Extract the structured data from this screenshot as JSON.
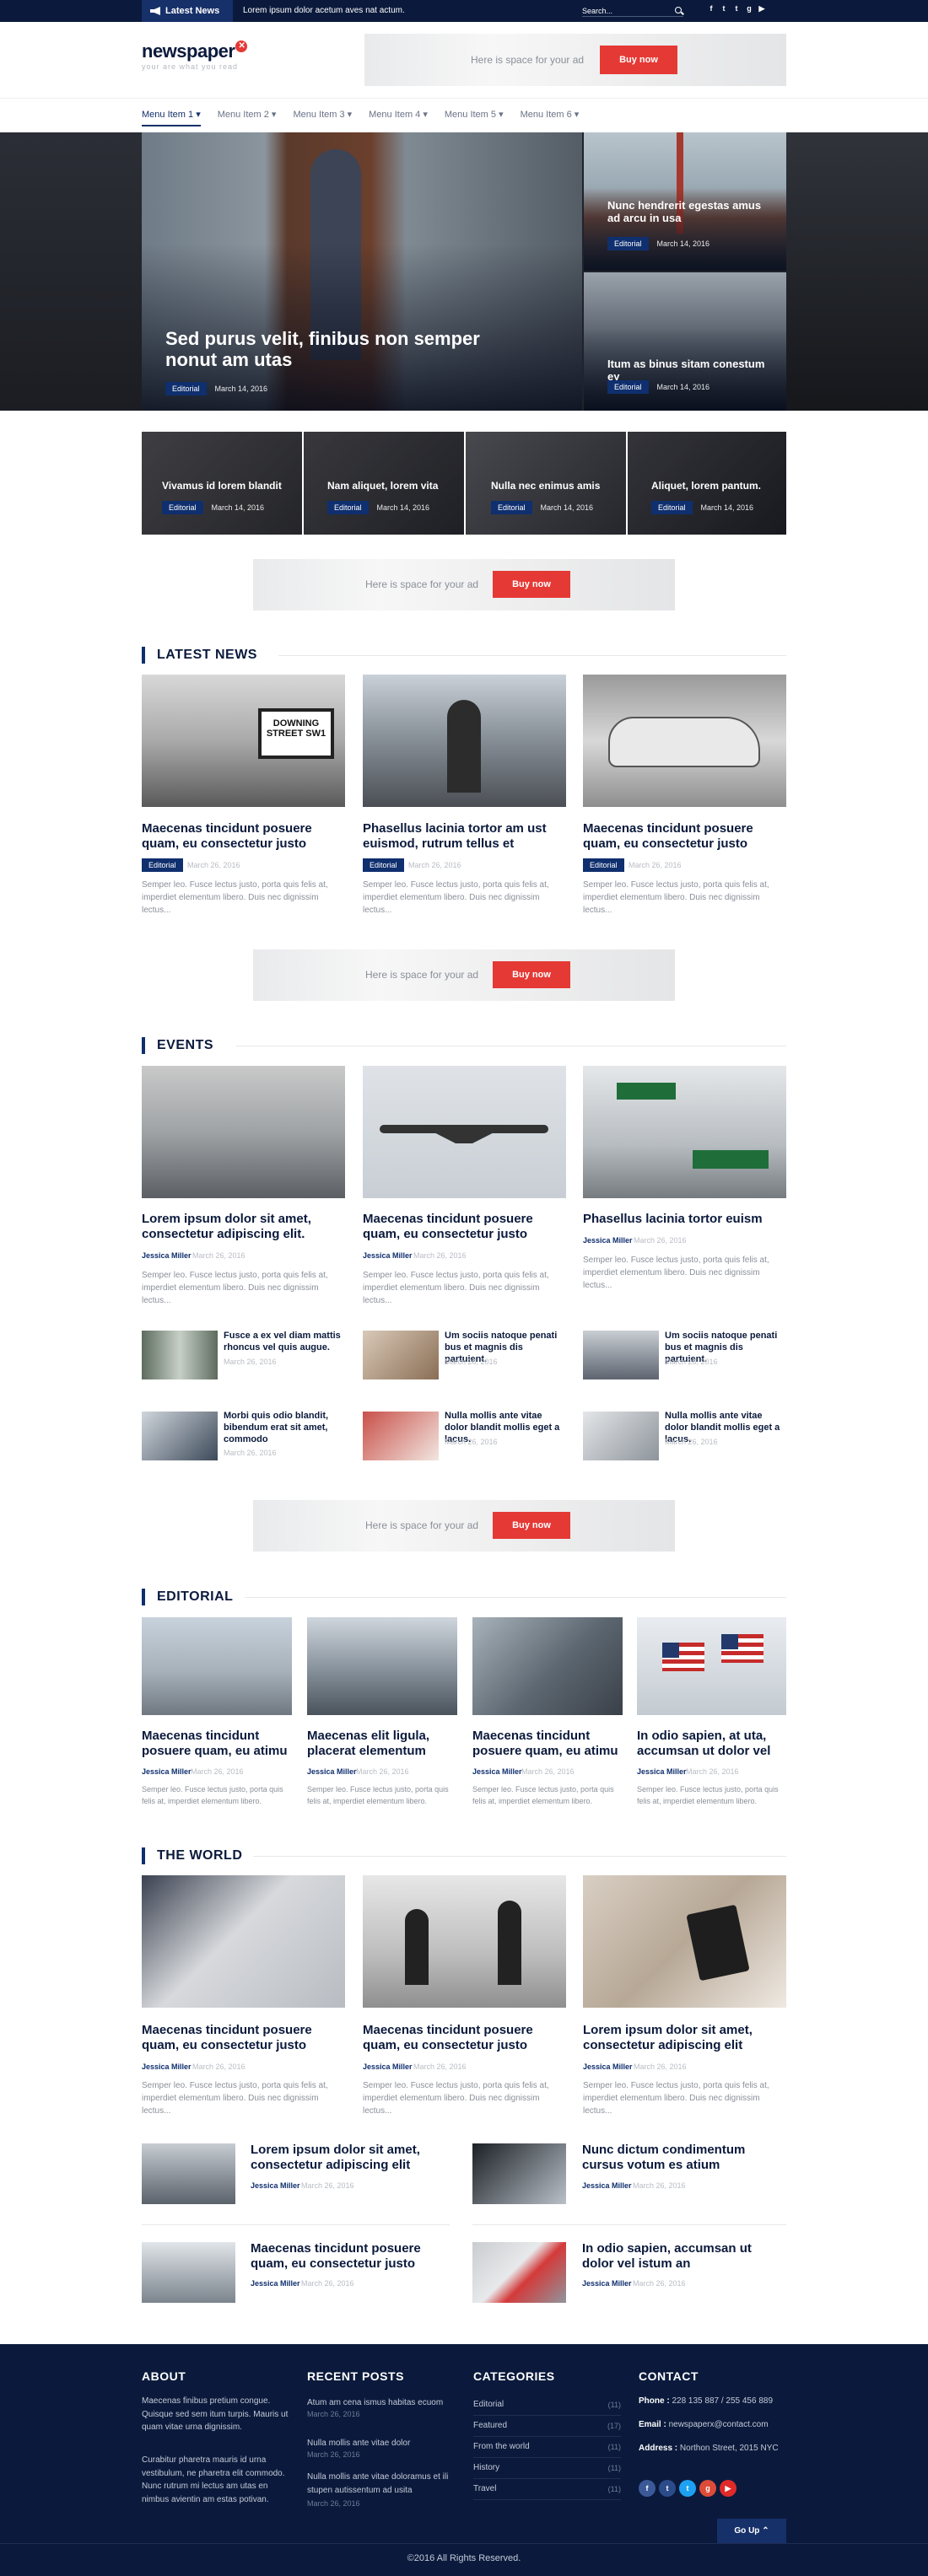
{
  "topbar": {
    "latest_label": "Latest News",
    "latest_text": "Lorem ipsum dolor acetum aves nat actum.",
    "search_placeholder": "Search..."
  },
  "brand": {
    "name": "newspaper",
    "tagline": "your are what you read"
  },
  "header_ad": {
    "text": "Here is space for your ad",
    "button": "Buy now"
  },
  "menu": [
    "Menu Item 1",
    "Menu Item 2",
    "Menu Item 3",
    "Menu Item 4",
    "Menu Item 5",
    "Menu Item 6"
  ],
  "hero": {
    "main": {
      "title": "Sed purus velit, finibus non semper nonut am utas",
      "category": "Editorial",
      "date": "March 14, 2016"
    },
    "side": [
      {
        "title": "Nunc hendrerit egestas amus ad arcu in usa",
        "category": "Editorial",
        "date": "March 14, 2016"
      },
      {
        "title": "Itum as binus sitam conestum ey",
        "category": "Editorial",
        "date": "March 14, 2016"
      }
    ]
  },
  "strip": [
    {
      "title": "Vivamus id lorem blandit",
      "category": "Editorial",
      "date": "March 14, 2016"
    },
    {
      "title": "Nam aliquet, lorem vita",
      "category": "Editorial",
      "date": "March 14, 2016"
    },
    {
      "title": "Nulla nec enimus amis",
      "category": "Editorial",
      "date": "March 14, 2016"
    },
    {
      "title": "Aliquet, lorem pantum.",
      "category": "Editorial",
      "date": "March 14, 2016"
    }
  ],
  "ad": {
    "text": "Here is space for your ad",
    "button": "Buy now"
  },
  "latest_news": {
    "heading": "LATEST NEWS",
    "cards": [
      {
        "title": "Maecenas tincidunt posuere quam, eu consectetur justo",
        "category": "Editorial",
        "date": "March 26, 2016",
        "excerpt": "Semper leo. Fusce lectus justo, porta quis felis at, imperdiet elementum libero. Duis nec dignissim lectus..."
      },
      {
        "title": "Phasellus lacinia tortor am ust euismod, rutrum tellus et",
        "category": "Editorial",
        "date": "March 26, 2016",
        "excerpt": "Semper leo. Fusce lectus justo, porta quis felis at, imperdiet elementum libero. Duis nec dignissim lectus..."
      },
      {
        "title": "Maecenas tincidunt posuere quam, eu consectetur justo",
        "category": "Editorial",
        "date": "March 26, 2016",
        "excerpt": "Semper leo. Fusce lectus justo, porta quis felis at, imperdiet elementum libero. Duis nec dignissim lectus..."
      }
    ]
  },
  "events": {
    "heading": "EVENTS",
    "cards": [
      {
        "title": "Lorem ipsum dolor sit amet, consectetur adipiscing elit.",
        "author": "Jessica Miller",
        "date": "March 26, 2016",
        "excerpt": "Semper leo. Fusce lectus justo, porta quis felis at, imperdiet elementum libero. Duis nec dignissim lectus..."
      },
      {
        "title": "Maecenas tincidunt posuere quam, eu consectetur justo",
        "author": "Jessica Miller",
        "date": "March 26, 2016",
        "excerpt": "Semper leo. Fusce lectus justo, porta quis felis at, imperdiet elementum libero. Duis nec dignissim lectus..."
      },
      {
        "title": "Phasellus lacinia tortor euism",
        "author": "Jessica Miller",
        "date": "March 26, 2016",
        "excerpt": "Semper leo. Fusce lectus justo, porta quis felis at, imperdiet elementum libero. Duis nec dignissim lectus..."
      }
    ],
    "small": [
      {
        "title": "Fusce a ex vel diam mattis rhoncus vel quis augue.",
        "date": "March 26, 2016"
      },
      {
        "title": "Um sociis natoque penati bus et magnis dis partuient.",
        "date": "March 26, 2016"
      },
      {
        "title": "Um sociis natoque penati bus et magnis dis partuient.",
        "date": "March 26, 2016"
      },
      {
        "title": "Morbi quis odio blandit, bibendum erat sit amet, commodo",
        "date": "March 26, 2016"
      },
      {
        "title": "Nulla mollis ante vitae dolor blandit mollis eget a lacus.",
        "date": "March 26, 2016"
      },
      {
        "title": "Nulla mollis ante vitae dolor blandit mollis eget a lacus.",
        "date": "March 26, 2016"
      }
    ]
  },
  "editorial": {
    "heading": "EDITORIAL",
    "cards": [
      {
        "title": "Maecenas tincidunt posuere quam, eu atimu",
        "author": "Jessica Miller",
        "date": "March 26, 2016",
        "excerpt": "Semper leo. Fusce lectus justo, porta quis felis at, imperdiet elementum libero."
      },
      {
        "title": "Maecenas elit ligula, placerat elementum",
        "author": "Jessica Miller",
        "date": "March 26, 2016",
        "excerpt": "Semper leo. Fusce lectus justo, porta quis felis at, imperdiet elementum libero."
      },
      {
        "title": "Maecenas tincidunt posuere quam, eu atimu",
        "author": "Jessica Miller",
        "date": "March 26, 2016",
        "excerpt": "Semper leo. Fusce lectus justo, porta quis felis at, imperdiet elementum libero."
      },
      {
        "title": "In odio sapien, at uta, accumsan ut dolor vel",
        "author": "Jessica Miller",
        "date": "March 26, 2016",
        "excerpt": "Semper leo. Fusce lectus justo, porta quis felis at, imperdiet elementum libero."
      }
    ]
  },
  "world": {
    "heading": "THE WORLD",
    "cards": [
      {
        "title": "Maecenas tincidunt posuere quam, eu consectetur justo",
        "author": "Jessica Miller",
        "date": "March 26, 2016",
        "excerpt": "Semper leo. Fusce lectus justo, porta quis felis at, imperdiet elementum libero. Duis nec dignissim lectus..."
      },
      {
        "title": "Maecenas tincidunt posuere quam, eu consectetur justo",
        "author": "Jessica Miller",
        "date": "March 26, 2016",
        "excerpt": "Semper leo. Fusce lectus justo, porta quis felis at, imperdiet elementum libero. Duis nec dignissim lectus..."
      },
      {
        "title": "Lorem ipsum dolor sit amet, consectetur adipiscing elit",
        "author": "Jessica Miller",
        "date": "March 26, 2016",
        "excerpt": "Semper leo. Fusce lectus justo, porta quis felis at, imperdiet elementum libero. Duis nec dignissim lectus..."
      }
    ],
    "list": [
      {
        "title": "Lorem ipsum dolor sit amet, consectetur adipiscing elit",
        "author": "Jessica Miller",
        "date": "March 26, 2016"
      },
      {
        "title": "Nunc dictum condimentum cursus votum es atium",
        "author": "Jessica Miller",
        "date": "March 26, 2016"
      },
      {
        "title": "Maecenas tincidunt posuere quam, eu consectetur justo",
        "author": "Jessica Miller",
        "date": "March 26, 2016"
      },
      {
        "title": "In odio sapien, accumsan ut dolor vel istum an",
        "author": "Jessica Miller",
        "date": "March 26, 2016"
      }
    ]
  },
  "footer": {
    "about": {
      "heading": "ABOUT",
      "p1": "Maecenas finibus pretium congue. Quisque sed sem itum turpis. Mauris ut quam vitae urna dignissim.",
      "p2": "Curabitur pharetra mauris id urna vestibulum, ne pharetra elit commodo. Nunc rutrum mi lectus am utas en nimbus avientin am estas potivan."
    },
    "recent": {
      "heading": "RECENT POSTS",
      "items": [
        {
          "title": "Atum am cena ismus habitas ecuom",
          "date": "March 26, 2016"
        },
        {
          "title": "Nulla mollis ante vitae dolor",
          "date": "March 26, 2016"
        },
        {
          "title": "Nulla mollis ante vitae doloramus et ili stupen autissentum ad usita",
          "date": "March 26, 2016"
        }
      ]
    },
    "categories": {
      "heading": "CATEGORIES",
      "items": [
        {
          "label": "Editorial",
          "count": "(11)"
        },
        {
          "label": "Featured",
          "count": "(17)"
        },
        {
          "label": "From the world",
          "count": "(11)"
        },
        {
          "label": "History",
          "count": "(11)"
        },
        {
          "label": "Travel",
          "count": "(11)"
        }
      ]
    },
    "contact": {
      "heading": "CONTACT",
      "phone_label": "Phone :",
      "phone": "228 135 887 / 255 456 889",
      "email_label": "Email :",
      "email": "newspaperx@contact.com",
      "address_label": "Address :",
      "address": "Northon Street, 2015 NYC"
    },
    "go_up": "Go Up",
    "copyright": "©2016 All Rights Reserved."
  },
  "colors": {
    "navy": "#0b1a3c",
    "badge": "#0f2f6e",
    "accent": "#e53935"
  }
}
